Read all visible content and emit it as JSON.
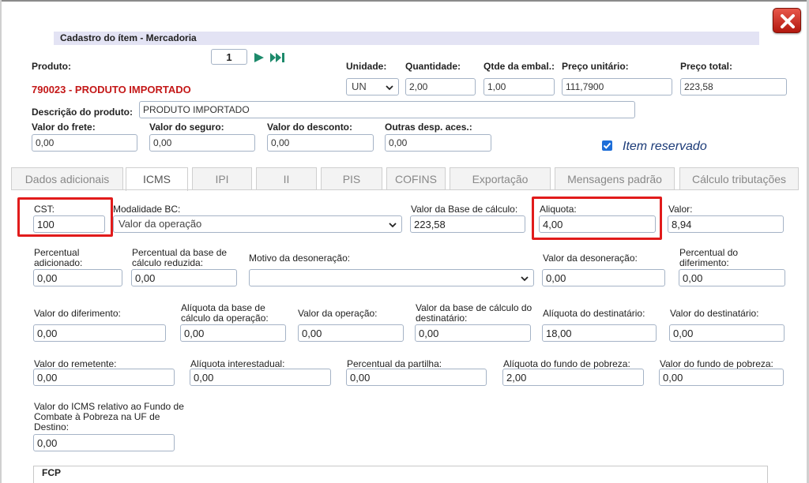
{
  "header": {
    "title": "Cadastro do ítem - Mercadoria",
    "page_number": "1"
  },
  "produto": {
    "label": "Produto:",
    "code_name": "790023 - PRODUTO IMPORTADO",
    "unidade_label": "Unidade:",
    "unidade_value": "UN",
    "quantidade_label": "Quantidade:",
    "quantidade_value": "2,00",
    "qtde_embal_label": "Qtde da embal.:",
    "qtde_embal_value": "1,00",
    "preco_unitario_label": "Preço unitário:",
    "preco_unitario_value": "111,7900",
    "preco_total_label": "Preço total:",
    "preco_total_value": "223,58",
    "descricao_label": "Descrição do produto:",
    "descricao_value": "PRODUTO IMPORTADO"
  },
  "valores": {
    "frete_label": "Valor do frete:",
    "frete_value": "0,00",
    "seguro_label": "Valor do seguro:",
    "seguro_value": "0,00",
    "desconto_label": "Valor do desconto:",
    "desconto_value": "0,00",
    "outras_label": "Outras desp. aces.:",
    "outras_value": "0,00",
    "item_reservado_label": "Item reservado"
  },
  "tabs": [
    "Dados adicionais",
    "ICMS",
    "IPI",
    "II",
    "PIS",
    "COFINS",
    "Exportação",
    "Mensagens padrão",
    "Cálculo tributações"
  ],
  "icms": {
    "cst_label": "CST:",
    "cst_value": "100",
    "modalidade_label": "Modalidade BC:",
    "modalidade_value": "Valor da operação",
    "base_calculo_label": "Valor da Base de cálculo:",
    "base_calculo_value": "223,58",
    "aliquota_label": "Aliquota:",
    "aliquota_value": "4,00",
    "valor_label": "Valor:",
    "valor_value": "8,94",
    "perc_adicionado_label": "Percentual adicionado:",
    "perc_adicionado_value": "0,00",
    "perc_base_reduzida_label": "Percentual da base de cálculo reduzida:",
    "perc_base_reduzida_value": "0,00",
    "motivo_desoneracao_label": "Motivo da desoneração:",
    "motivo_desoneracao_value": "",
    "valor_desoneracao_label": "Valor da desoneração:",
    "valor_desoneracao_value": "0,00",
    "perc_diferimento_label": "Percentual do diferimento:",
    "perc_diferimento_value": "0,00",
    "valor_diferimento_label": "Valor do diferimento:",
    "valor_diferimento_value": "0,00",
    "aliq_base_operacao_label": "Alíquota da base de cálculo da operação:",
    "aliq_base_operacao_value": "0,00",
    "valor_operacao_label": "Valor da operação:",
    "valor_operacao_value": "0,00",
    "valor_base_destinatario_label": "Valor da base de cálculo do destinatário:",
    "valor_base_destinatario_value": "0,00",
    "aliq_destinatario_label": "Alíquota do destinatário:",
    "aliq_destinatario_value": "18,00",
    "valor_destinatario_label": "Valor do destinatário:",
    "valor_destinatario_value": "0,00",
    "valor_remetente_label": "Valor do remetente:",
    "valor_remetente_value": "0,00",
    "aliq_interestadual_label": "Alíquota interestadual:",
    "aliq_interestadual_value": "0,00",
    "perc_partilha_label": "Percentual da partilha:",
    "perc_partilha_value": "0,00",
    "aliq_fundo_pobreza_label": "Alíquota do fundo de pobreza:",
    "aliq_fundo_pobreza_value": "2,00",
    "valor_fundo_pobreza_label": "Valor do fundo de pobreza:",
    "valor_fundo_pobreza_value": "0,00",
    "valor_icms_fcp_uf_label": "Valor do ICMS relativo ao Fundo de Combate à Pobreza na UF de Destino:",
    "valor_icms_fcp_uf_value": "0,00",
    "fcp_section_label": "FCP"
  },
  "colors": {
    "accent_green": "#1d8a6b",
    "highlight_red": "#e11b1b",
    "product_red": "#c41818",
    "reserved_blue": "#1c3b78"
  },
  "icons": {
    "close": "close-icon",
    "play": "play-icon",
    "skip_forward": "skip-forward-icon",
    "chevron": "chevron-down-icon",
    "checkbox": "checkbox-checked-icon"
  }
}
